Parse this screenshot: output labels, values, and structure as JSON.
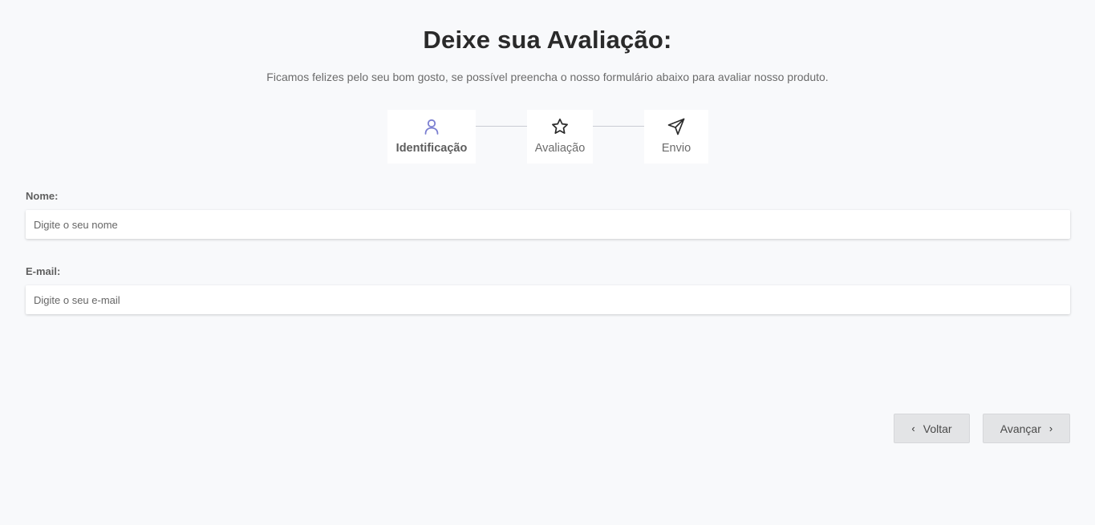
{
  "header": {
    "title": "Deixe sua Avaliação:",
    "subtitle": "Ficamos felizes pelo seu bom gosto, se possível preencha o nosso formulário abaixo para avaliar nosso produto."
  },
  "steps": [
    {
      "label": "Identificação",
      "icon": "user-icon",
      "active": true
    },
    {
      "label": "Avaliação",
      "icon": "star-icon",
      "active": false
    },
    {
      "label": "Envio",
      "icon": "send-icon",
      "active": false
    }
  ],
  "form": {
    "name": {
      "label": "Nome:",
      "placeholder": "Digite o seu nome",
      "value": ""
    },
    "email": {
      "label": "E-mail:",
      "placeholder": "Digite o seu e-mail",
      "value": ""
    }
  },
  "buttons": {
    "back": {
      "label": "Voltar",
      "icon": "chevron-left-icon"
    },
    "next": {
      "label": "Avançar",
      "icon": "chevron-right-icon"
    }
  },
  "colors": {
    "accent": "#7b7fd1",
    "background": "#f8f9fb",
    "button": "#e3e4e6"
  }
}
